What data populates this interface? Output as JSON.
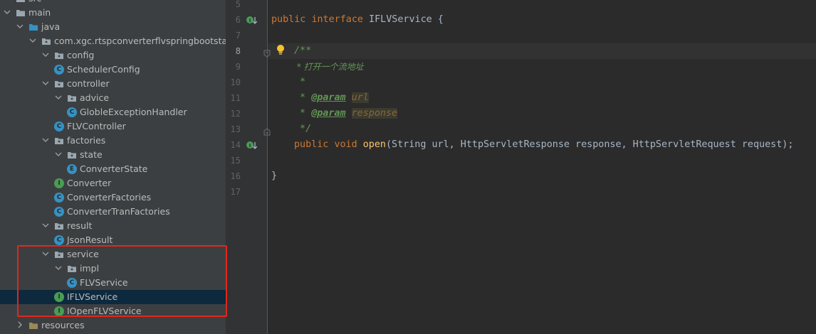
{
  "project_tree": {
    "rows": [
      {
        "label": "src"
      },
      {
        "label": "main"
      },
      {
        "label": "java"
      },
      {
        "label": "com.xgc.rtspconverterflvspringbootstarter"
      },
      {
        "label": "config"
      },
      {
        "label": "SchedulerConfig",
        "kind": "C"
      },
      {
        "label": "controller"
      },
      {
        "label": "advice"
      },
      {
        "label": "GlobleExceptionHandler",
        "kind": "C"
      },
      {
        "label": "FLVController",
        "kind": "C"
      },
      {
        "label": "factories"
      },
      {
        "label": "state"
      },
      {
        "label": "ConverterState",
        "kind": "E"
      },
      {
        "label": "Converter",
        "kind": "I"
      },
      {
        "label": "ConverterFactories",
        "kind": "C"
      },
      {
        "label": "ConverterTranFactories",
        "kind": "C"
      },
      {
        "label": "result"
      },
      {
        "label": "JsonResult",
        "kind": "C"
      },
      {
        "label": "service"
      },
      {
        "label": "impl"
      },
      {
        "label": "FLVService",
        "kind": "C"
      },
      {
        "label": "IFLVService",
        "kind": "I",
        "selected": true
      },
      {
        "label": "IOpenFLVService",
        "kind": "I"
      },
      {
        "label": "resources"
      }
    ],
    "highlight_color": "#e3261b",
    "selected_row_color": "#0d293e"
  },
  "editor": {
    "line_numbers": [
      "5",
      "6",
      "7",
      "8",
      "9",
      "10",
      "11",
      "12",
      "13",
      "14",
      "15",
      "16",
      "17"
    ],
    "active_line": "8",
    "code": {
      "l6_kw1": "public",
      "l6_kw2": "interface",
      "l6_rest": " IFLVService {",
      "l8": "/**",
      "l9": " * 打开一个流地址",
      "l10": " *",
      "l11_star": " * ",
      "l11_tag": "@param",
      "l11_val": "url",
      "l12_star": " * ",
      "l12_tag": "@param",
      "l12_val": "response",
      "l13": " */",
      "l14_kw1": "public",
      "l14_kw2": "void",
      "l14_fn": "open",
      "l14_rest": "(String url, HttpServletResponse response, HttpServletRequest request);",
      "l16": "}"
    },
    "gutter_icons": [
      "implemented-down-arrow-icon",
      "lightbulb-icon",
      "fold-icon"
    ],
    "colors": {
      "background": "#2b2b2b",
      "keyword": "#cc7832",
      "method": "#ffc66d",
      "doc_comment": "#629755",
      "text": "#a9b7c6"
    }
  }
}
